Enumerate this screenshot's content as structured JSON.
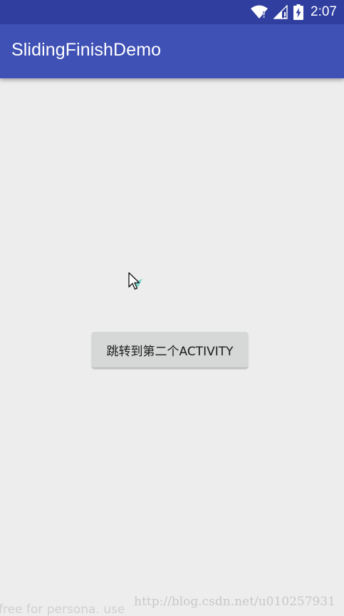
{
  "status_bar": {
    "time": "2:07",
    "icons": [
      "wifi-icon",
      "signal-icon",
      "battery-charging-icon"
    ],
    "color": "#303f9f"
  },
  "app_bar": {
    "title": "SlidingFinishDemo",
    "color": "#3f51b5"
  },
  "main": {
    "button_label": "跳转到第二个ACTIVITY"
  },
  "watermarks": {
    "url": "http://blog.csdn.net/u010257931",
    "license": "free for persona. use"
  },
  "colors": {
    "background": "#ededed",
    "button": "#d6d7d7"
  }
}
